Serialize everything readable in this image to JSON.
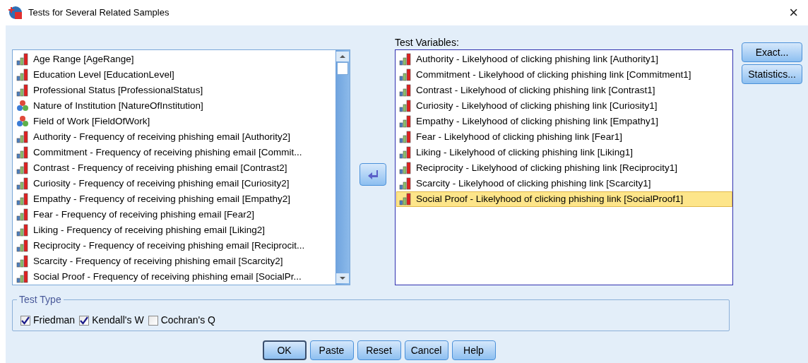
{
  "window": {
    "title": "Tests for Several Related Samples",
    "close": "×"
  },
  "source_list": {
    "items": [
      {
        "label": "Age Range [AgeRange]",
        "kind": "ordinal"
      },
      {
        "label": "Education Level [EducationLevel]",
        "kind": "ordinal"
      },
      {
        "label": "Professional Status [ProfessionalStatus]",
        "kind": "ordinal"
      },
      {
        "label": "Nature of Institution [NatureOfInstitution]",
        "kind": "nominal"
      },
      {
        "label": "Field of Work [FieldOfWork]",
        "kind": "nominal"
      },
      {
        "label": "Authority - Frequency of receiving phishing email [Authority2]",
        "kind": "ordinal"
      },
      {
        "label": "Commitment - Frequency of receiving phishing email [Commit...",
        "kind": "ordinal"
      },
      {
        "label": "Contrast - Frequency of receiving phishing email [Contrast2]",
        "kind": "ordinal"
      },
      {
        "label": "Curiosity - Frequency of receiving phishing email [Curiosity2]",
        "kind": "ordinal"
      },
      {
        "label": "Empathy - Frequency of receiving phishing email [Empathy2]",
        "kind": "ordinal"
      },
      {
        "label": "Fear - Frequency of receiving phishing email [Fear2]",
        "kind": "ordinal"
      },
      {
        "label": "Liking - Frequency of receiving phishing email [Liking2]",
        "kind": "ordinal"
      },
      {
        "label": "Reciprocity - Frequency of receiving phishing email [Reciprocit...",
        "kind": "ordinal"
      },
      {
        "label": "Scarcity - Frequency of receiving phishing email [Scarcity2]",
        "kind": "ordinal"
      },
      {
        "label": "Social Proof - Frequency of receiving phishing email [SocialPr...",
        "kind": "ordinal"
      }
    ]
  },
  "test_variables": {
    "label": "Test Variables:",
    "items": [
      {
        "label": "Authority - Likelyhood of clicking phishing link [Authority1]",
        "kind": "ordinal",
        "selected": false
      },
      {
        "label": "Commitment - Likelyhood of clicking phishing link [Commitment1]",
        "kind": "ordinal",
        "selected": false
      },
      {
        "label": "Contrast - Likelyhood of clicking phishing link [Contrast1]",
        "kind": "ordinal",
        "selected": false
      },
      {
        "label": "Curiosity - Likelyhood of clicking phishing link [Curiosity1]",
        "kind": "ordinal",
        "selected": false
      },
      {
        "label": "Empathy - Likelyhood of clicking phishing link [Empathy1]",
        "kind": "ordinal",
        "selected": false
      },
      {
        "label": "Fear - Likelyhood of clicking phishing link [Fear1]",
        "kind": "ordinal",
        "selected": false
      },
      {
        "label": "Liking - Likelyhood of clicking phishing link [Liking1]",
        "kind": "ordinal",
        "selected": false
      },
      {
        "label": "Reciprocity - Likelyhood of clicking phishing link [Reciprocity1]",
        "kind": "ordinal",
        "selected": false
      },
      {
        "label": "Scarcity - Likelyhood of clicking phishing link [Scarcity1]",
        "kind": "ordinal",
        "selected": false
      },
      {
        "label": "Social Proof - Likelyhood of clicking phishing link [SocialProof1]",
        "kind": "ordinal",
        "selected": true
      }
    ]
  },
  "side_buttons": [
    "Exact...",
    "Statistics..."
  ],
  "test_type": {
    "title": "Test Type",
    "options": [
      {
        "label": "Friedman",
        "checked": true
      },
      {
        "label": "Kendall's W",
        "checked": true
      },
      {
        "label": "Cochran's Q",
        "checked": false
      }
    ]
  },
  "buttons": [
    {
      "label": "OK",
      "default": true
    },
    {
      "label": "Paste",
      "default": false
    },
    {
      "label": "Reset",
      "default": false
    },
    {
      "label": "Cancel",
      "default": false
    },
    {
      "label": "Help",
      "default": false
    }
  ]
}
